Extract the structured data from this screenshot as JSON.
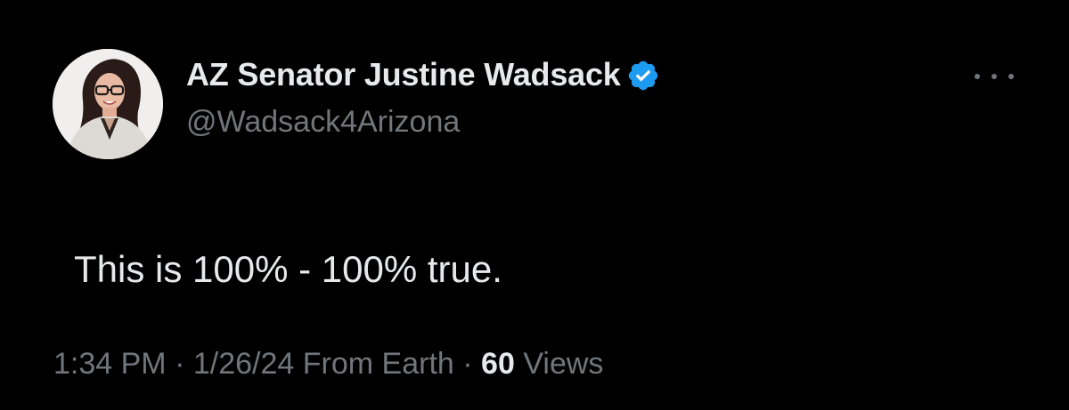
{
  "tweet": {
    "author": {
      "display_name": "AZ Senator Justine Wadsack",
      "handle": "@Wadsack4Arizona",
      "verified": true,
      "avatar_icon": "profile-photo",
      "verified_icon": "verified-badge-icon",
      "verified_color": "#1d9bf0"
    },
    "text": "This is 100% - 100% true.",
    "time": "1:34 PM",
    "separator": "·",
    "date": "1/26/24",
    "source": "From Earth",
    "views_count": "60",
    "views_label": "Views",
    "more_icon": "more-options-icon"
  },
  "colors": {
    "background": "#000000",
    "primary_text": "#e7e9ea",
    "secondary_text": "#71767b"
  }
}
